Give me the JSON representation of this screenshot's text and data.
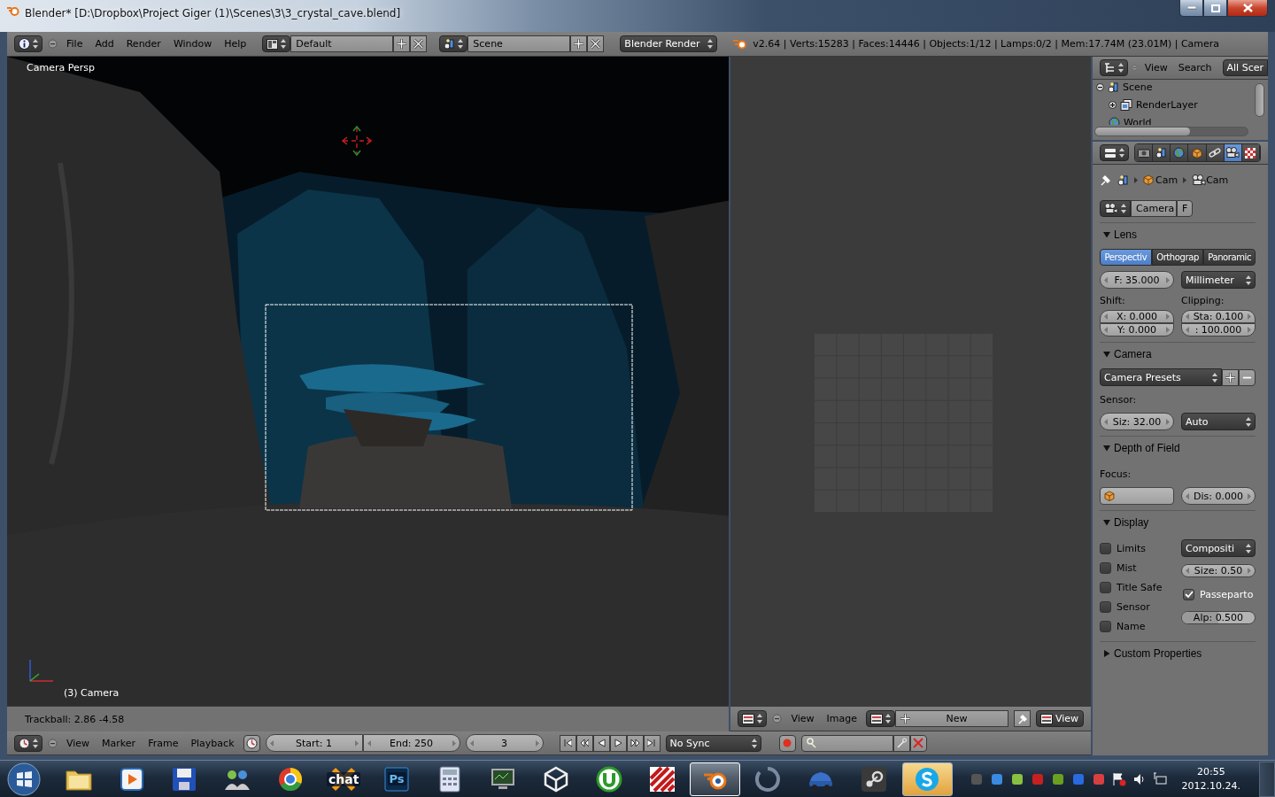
{
  "window": {
    "title": "Blender* [D:\\Dropbox\\Project Giger (1)\\Scenes\\3\\3_crystal_cave.blend]"
  },
  "info_header": {
    "menus": [
      "File",
      "Add",
      "Render",
      "Window",
      "Help"
    ],
    "layout": "Default",
    "scene": "Scene",
    "engine": "Blender Render",
    "stats": "v2.64 | Verts:15283 | Faces:14446 | Objects:1/12 | Lamps:0/2 | Mem:17.74M (23.01M) | Camera"
  },
  "viewport": {
    "view_name": "Camera Persp",
    "object_name": "(3) Camera",
    "status": "Trackball: 2.86 -4.58"
  },
  "image_editor": {
    "menus": [
      "View",
      "Image"
    ],
    "new_button": "New",
    "view_button": "View"
  },
  "outliner": {
    "menus": [
      "View",
      "Search"
    ],
    "display_mode": "All Scer",
    "items": [
      {
        "label": "Scene",
        "kind": "scene",
        "expanded": true,
        "children": [
          {
            "label": "RenderLayer",
            "kind": "renderlayer",
            "expanded": false
          },
          {
            "label": "World",
            "kind": "world"
          }
        ]
      }
    ]
  },
  "properties": {
    "tabs": [
      {
        "kind": "render",
        "selected": false
      },
      {
        "kind": "scene",
        "selected": false
      },
      {
        "kind": "world",
        "selected": false
      },
      {
        "kind": "object",
        "selected": false
      },
      {
        "kind": "constraints",
        "selected": false
      },
      {
        "kind": "data",
        "selected": true
      },
      {
        "kind": "texture",
        "selected": false
      }
    ],
    "breadcrumb": [
      "Cam",
      "Cam"
    ],
    "datablock": "Camera",
    "fake_user": "F",
    "panels": [
      {
        "kind": "lens",
        "title": "Lens",
        "expanded": true,
        "lens_types": [
          {
            "label": "Perspectiv",
            "selected": true
          },
          {
            "label": "Orthograp",
            "selected": false
          },
          {
            "label": "Panoramic",
            "selected": false
          }
        ],
        "focal_length": "F: 35.000",
        "unit": "Millimeter",
        "shift_label": "Shift:",
        "shift": [
          "X: 0.000",
          "Y: 0.000"
        ],
        "clipping_label": "Clipping:",
        "clipping": [
          "Sta: 0.100",
          ": 100.000"
        ]
      },
      {
        "kind": "camera",
        "title": "Camera",
        "expanded": true,
        "presets": "Camera Presets",
        "sensor_label": "Sensor:",
        "sensor_size": "Siz: 32.00",
        "sensor_fit": "Auto"
      },
      {
        "kind": "dof",
        "title": "Depth of Field",
        "expanded": true,
        "focus_label": "Focus:",
        "distance": "Dis: 0.000"
      },
      {
        "kind": "display",
        "title": "Display",
        "expanded": true,
        "options": [
          {
            "label": "Limits",
            "checked": false
          },
          {
            "label": "Mist",
            "checked": false
          },
          {
            "label": "Title Safe",
            "checked": false
          },
          {
            "label": "Sensor",
            "checked": false
          },
          {
            "label": "Name",
            "checked": false
          }
        ],
        "guides": "Compositi",
        "size": "Size: 0.50",
        "passepartout": {
          "label": "Passeparto",
          "checked": true
        },
        "alpha": {
          "text": "Alp: 0.500",
          "level": 0.5
        }
      },
      {
        "title": "Custom Properties",
        "expanded": false
      }
    ]
  },
  "timeline": {
    "menus": [
      "View",
      "Marker",
      "Frame",
      "Playback"
    ],
    "start": "Start: 1",
    "end": "End: 250",
    "current": "3",
    "sync": "No Sync"
  },
  "taskbar": {
    "apps": [
      {
        "kind": "folder",
        "selected": false,
        "attention": false
      },
      {
        "kind": "media",
        "selected": false,
        "attention": false
      },
      {
        "kind": "floppy",
        "selected": false,
        "attention": false
      },
      {
        "kind": "people",
        "selected": false,
        "attention": false
      },
      {
        "kind": "ring",
        "selected": false,
        "attention": false
      },
      {
        "kind": "chat",
        "label": "chat",
        "selected": false,
        "attention": false
      },
      {
        "kind": "photoshop",
        "label": "Ps",
        "selected": false,
        "attention": false
      },
      {
        "kind": "calculator",
        "selected": false,
        "attention": false
      },
      {
        "kind": "monitor",
        "selected": false,
        "attention": false
      },
      {
        "kind": "cube",
        "selected": false,
        "attention": false
      },
      {
        "kind": "torrent",
        "selected": false,
        "attention": false
      },
      {
        "kind": "stripes",
        "selected": false,
        "attention": false
      },
      {
        "kind": "blender",
        "selected": true,
        "attention": false
      },
      {
        "kind": "spinner",
        "selected": false,
        "attention": false
      },
      {
        "kind": "car",
        "selected": false,
        "attention": false
      },
      {
        "kind": "steam",
        "selected": false,
        "attention": false
      },
      {
        "kind": "skype",
        "selected": false,
        "attention": true
      }
    ],
    "clock": "20:55",
    "date": "2012.10.24."
  }
}
